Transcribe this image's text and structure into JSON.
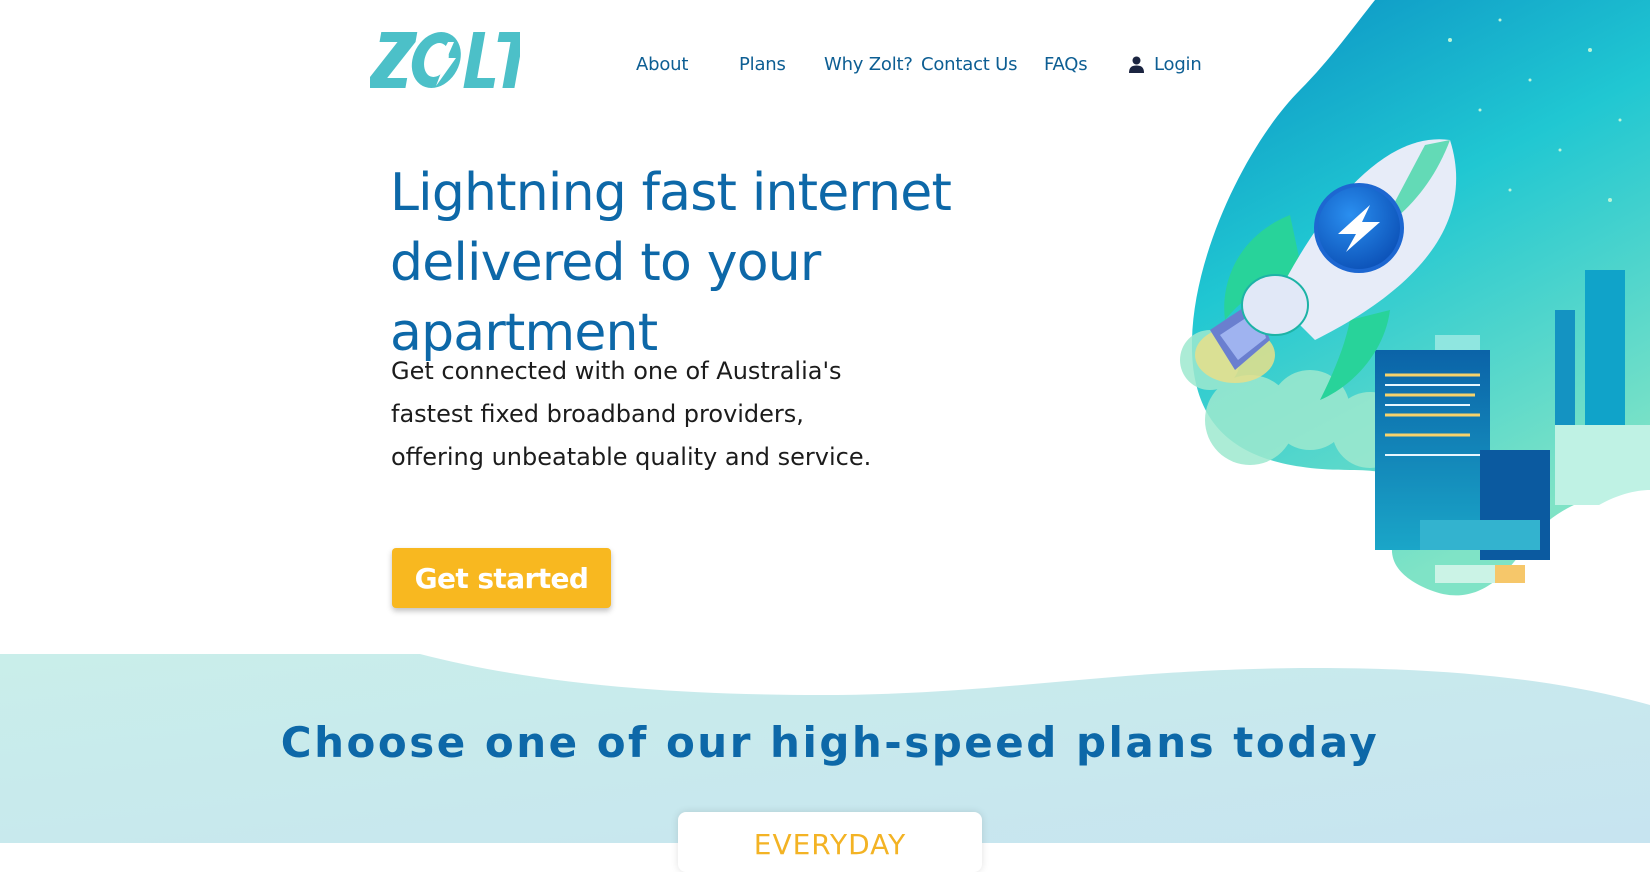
{
  "brand": {
    "logo_text": "ZOLT",
    "accent": "#4cc0c8",
    "primary": "#0d68a8",
    "cta": "#f8b820"
  },
  "nav": {
    "items": [
      {
        "label": "About"
      },
      {
        "label": "Plans"
      },
      {
        "label": "Why Zolt?"
      },
      {
        "label": "Contact Us"
      },
      {
        "label": "FAQs"
      }
    ],
    "login": {
      "label": "Login",
      "icon": "user-icon"
    }
  },
  "hero": {
    "title_lines": [
      "Lightning fast internet",
      "delivered to your apartment"
    ],
    "text_lines": [
      "Get connected with one of Australia's",
      "fastest fixed broadband providers,",
      "offering unbeatable quality and service."
    ],
    "cta_label": "Get started",
    "illustration": "rocket-city-illustration"
  },
  "plans": {
    "heading": "Choose one of our high-speed plans today",
    "cards": [
      {
        "name": "EVERYDAY"
      }
    ]
  }
}
